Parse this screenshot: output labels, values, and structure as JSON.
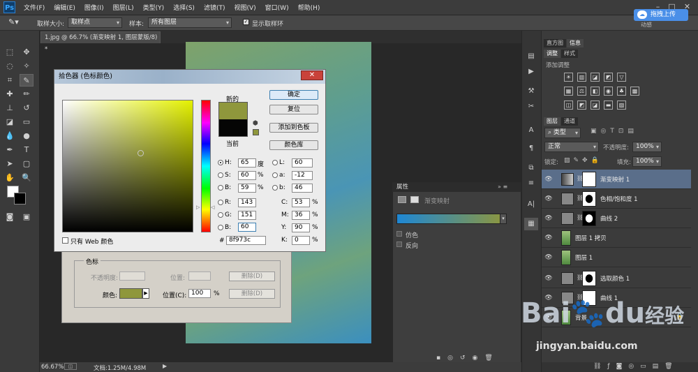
{
  "app": {
    "logo": "Ps",
    "menu": [
      "文件(F)",
      "编辑(E)",
      "图像(I)",
      "图层(L)",
      "类型(Y)",
      "选择(S)",
      "滤镜(T)",
      "视图(V)",
      "窗口(W)",
      "帮助(H)"
    ]
  },
  "options": {
    "sample_size_label": "取样大小:",
    "sample_size": "取样点",
    "sample_label": "样本:",
    "sample": "所有图层",
    "show_ring": "显示取样环",
    "upload": "拖拽上传",
    "workspace": "动感"
  },
  "document": {
    "tab": "1.jpg @ 66.7% (渐变映射 1, 图层蒙版/8) *",
    "zoom": "66.67%",
    "doc_info": "文档:1.25M/4.98M"
  },
  "color_picker": {
    "title": "拾色器 (色标颜色)",
    "new_label": "新的",
    "current_label": "当前",
    "buttons": {
      "ok": "确定",
      "reset": "复位",
      "add_swatch": "添加到色板",
      "libraries": "颜色库"
    },
    "only_web": "只有 Web 颜色",
    "fields": {
      "H": {
        "label": "H:",
        "value": "65",
        "unit": "度"
      },
      "S": {
        "label": "S:",
        "value": "60",
        "unit": "%"
      },
      "B": {
        "label": "B:",
        "value": "59",
        "unit": "%"
      },
      "R": {
        "label": "R:",
        "value": "143"
      },
      "G": {
        "label": "G:",
        "value": "151"
      },
      "Bl": {
        "label": "B:",
        "value": "60"
      },
      "L": {
        "label": "L:",
        "value": "60"
      },
      "a": {
        "label": "a:",
        "value": "-12"
      },
      "b": {
        "label": "b:",
        "value": "46"
      },
      "C": {
        "label": "C:",
        "value": "53",
        "unit": "%"
      },
      "M": {
        "label": "M:",
        "value": "36",
        "unit": "%"
      },
      "Y": {
        "label": "Y:",
        "value": "90",
        "unit": "%"
      },
      "K": {
        "label": "K:",
        "value": "0",
        "unit": "%"
      },
      "hex_label": "#",
      "hex": "8f973c"
    },
    "new_color": "#8f973c",
    "current_color": "#050505"
  },
  "gradient_editor": {
    "group_title": "色标",
    "opacity_label": "不透明度:",
    "position_label": "位置:",
    "delete_label": "删除(D)",
    "color_label": "颜色:",
    "position2_label": "位置(C):",
    "position_value": "100",
    "unit": "%"
  },
  "properties": {
    "tab": "属性",
    "title": "渐变映射",
    "dither": "仿色",
    "reverse": "反向"
  },
  "right_panel": {
    "tabs_top": [
      "直方图",
      "信息"
    ],
    "tabs_adj": [
      "调整",
      "样式"
    ],
    "add_adjustment": "添加调整",
    "tabs_layers": [
      "图层",
      "通道"
    ],
    "kind": "类型",
    "blend": "正常",
    "opacity_label": "不透明度:",
    "opacity": "100%",
    "lock_label": "锁定:",
    "fill_label": "填充:",
    "fill": "100%",
    "layers": [
      {
        "name": "渐变映射 1",
        "selected": true
      },
      {
        "name": "色相/饱和度 1",
        "selected": false
      },
      {
        "name": "曲线 2",
        "selected": false
      },
      {
        "name": "图层 1 拷贝",
        "selected": false
      },
      {
        "name": "图层 1",
        "selected": false
      },
      {
        "name": "选取颜色 1",
        "selected": false
      },
      {
        "name": "曲线 1",
        "selected": false
      },
      {
        "name": "背景",
        "selected": false
      }
    ]
  },
  "watermark": {
    "brand": "Bai",
    "du": "du",
    "jy": "经验",
    "url": "jingyan.baidu.com"
  }
}
